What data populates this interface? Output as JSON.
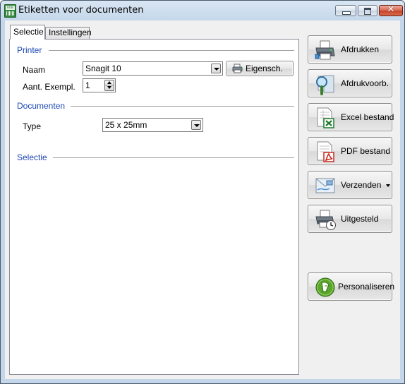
{
  "window": {
    "title": "Etiketten voor documenten",
    "app_icon_text": "ROB"
  },
  "tabs": [
    {
      "label": "Selectie",
      "selected": true
    },
    {
      "label": "Instellingen",
      "selected": false
    }
  ],
  "printer": {
    "group_label": "Printer",
    "name_label": "Naam",
    "name_value": "Snagit 10",
    "properties_button": "Eigensch.",
    "copies_label": "Aant. Exempl.",
    "copies_value": "1"
  },
  "documents": {
    "group_label": "Documenten",
    "type_label": "Type",
    "type_value": "25 x 25mm"
  },
  "selection": {
    "group_label": "Selectie"
  },
  "actions": {
    "print": "Afdrukken",
    "preview": "Afdrukvoorb.",
    "excel": "Excel bestand",
    "pdf": "PDF bestand",
    "send": "Verzenden",
    "deferred": "Uitgesteld",
    "personalize": "Personaliseren"
  },
  "colors": {
    "group_label": "#1c46b3",
    "close_button": "#c4432a",
    "excel_green": "#1f7a2e",
    "pdf_red": "#c62a1f",
    "personalize_green": "#5aa52b"
  }
}
